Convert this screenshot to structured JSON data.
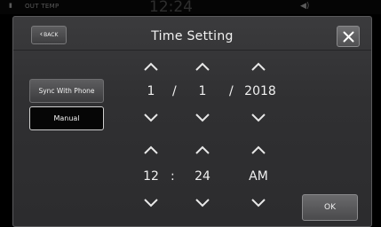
{
  "status_bar": {
    "out_temp_label": "OUT TEMP",
    "clock": "12:24"
  },
  "header": {
    "back_label": "BACK",
    "title": "Time Setting"
  },
  "sidebar": {
    "sync_label": "Sync With Phone",
    "manual_label": "Manual",
    "selected": "Manual"
  },
  "date": {
    "month": "1",
    "day": "1",
    "year": "2018",
    "separator": "/"
  },
  "time": {
    "hour": "12",
    "minute": "24",
    "period": "AM",
    "separator": ":"
  },
  "footer": {
    "ok_label": "OK"
  },
  "icons": {
    "back": "chevron-left-icon",
    "close": "close-icon",
    "up": "chevron-up-icon",
    "down": "chevron-down-icon"
  },
  "colors": {
    "background": "#2f2f31",
    "text": "#f0f0f0",
    "selected_button": "#060606"
  }
}
